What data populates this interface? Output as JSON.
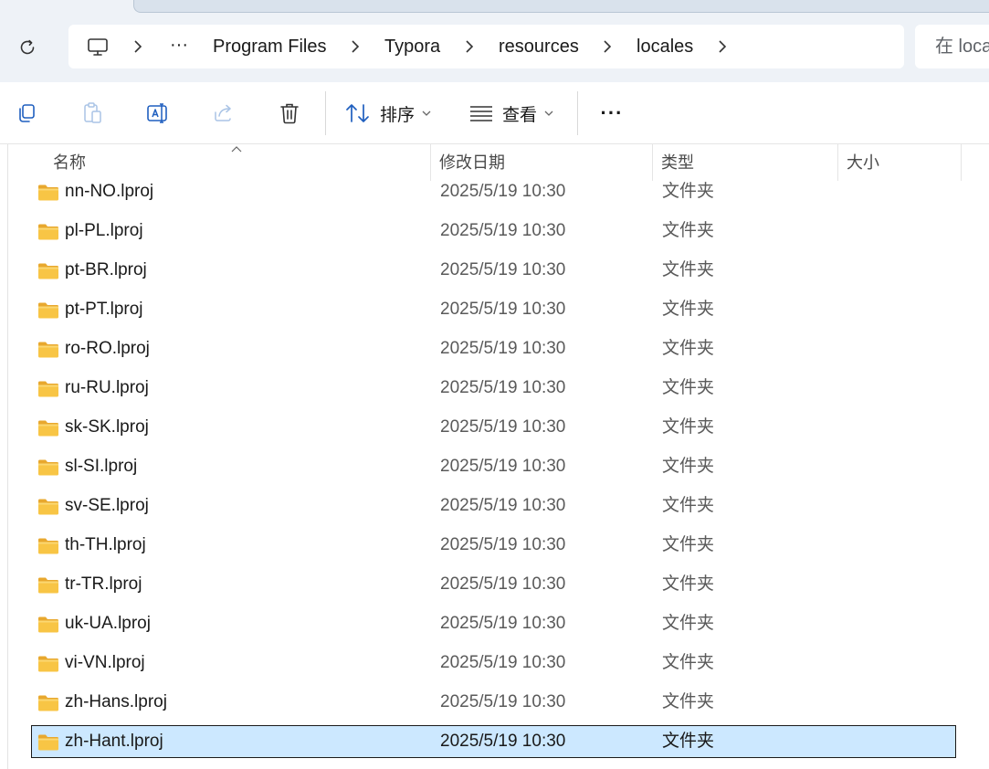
{
  "breadcrumb": {
    "overflow": "···",
    "items": [
      "Program Files",
      "Typora",
      "resources",
      "locales"
    ]
  },
  "search": {
    "placeholder": "在 loca"
  },
  "toolbar": {
    "sort_label": "排序",
    "view_label": "查看",
    "more_label": "···"
  },
  "columns": {
    "name": "名称",
    "modified": "修改日期",
    "type": "类型",
    "size": "大小"
  },
  "colors": {
    "selection_bg": "#cce8ff",
    "folder_yellow": "#f8c545",
    "accent_blue": "#1f5fbf"
  },
  "rows": [
    {
      "name": "nn-NO.lproj",
      "modified": "2025/5/19 10:30",
      "type": "文件夹",
      "selected": false
    },
    {
      "name": "pl-PL.lproj",
      "modified": "2025/5/19 10:30",
      "type": "文件夹",
      "selected": false
    },
    {
      "name": "pt-BR.lproj",
      "modified": "2025/5/19 10:30",
      "type": "文件夹",
      "selected": false
    },
    {
      "name": "pt-PT.lproj",
      "modified": "2025/5/19 10:30",
      "type": "文件夹",
      "selected": false
    },
    {
      "name": "ro-RO.lproj",
      "modified": "2025/5/19 10:30",
      "type": "文件夹",
      "selected": false
    },
    {
      "name": "ru-RU.lproj",
      "modified": "2025/5/19 10:30",
      "type": "文件夹",
      "selected": false
    },
    {
      "name": "sk-SK.lproj",
      "modified": "2025/5/19 10:30",
      "type": "文件夹",
      "selected": false
    },
    {
      "name": "sl-SI.lproj",
      "modified": "2025/5/19 10:30",
      "type": "文件夹",
      "selected": false
    },
    {
      "name": "sv-SE.lproj",
      "modified": "2025/5/19 10:30",
      "type": "文件夹",
      "selected": false
    },
    {
      "name": "th-TH.lproj",
      "modified": "2025/5/19 10:30",
      "type": "文件夹",
      "selected": false
    },
    {
      "name": "tr-TR.lproj",
      "modified": "2025/5/19 10:30",
      "type": "文件夹",
      "selected": false
    },
    {
      "name": "uk-UA.lproj",
      "modified": "2025/5/19 10:30",
      "type": "文件夹",
      "selected": false
    },
    {
      "name": "vi-VN.lproj",
      "modified": "2025/5/19 10:30",
      "type": "文件夹",
      "selected": false
    },
    {
      "name": "zh-Hans.lproj",
      "modified": "2025/5/19 10:30",
      "type": "文件夹",
      "selected": false
    },
    {
      "name": "zh-Hant.lproj",
      "modified": "2025/5/19 10:30",
      "type": "文件夹",
      "selected": true
    }
  ]
}
